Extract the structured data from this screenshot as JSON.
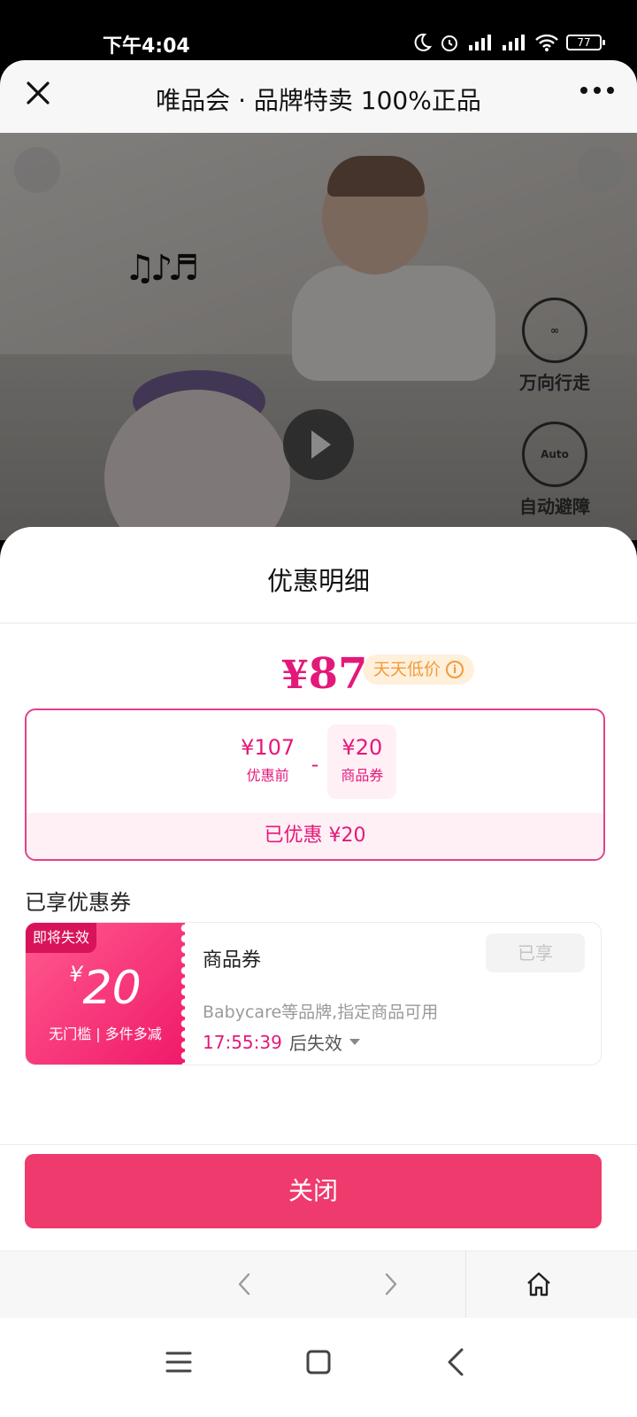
{
  "status_bar": {
    "time": "下午4:04",
    "battery": "77"
  },
  "title_bar": {
    "title": "唯品会 · 品牌特卖 100%正品"
  },
  "hero": {
    "features": [
      "万向行走",
      "自动避障"
    ],
    "auto_label": "Auto"
  },
  "discount_sheet": {
    "title": "优惠明细",
    "final_price": {
      "currency": "¥",
      "value": "87"
    },
    "daily_low_tag": "天天低价",
    "breakdown": [
      {
        "amount": "¥107",
        "label": "优惠前"
      },
      {
        "amount": "¥20",
        "label": "商品券"
      }
    ],
    "operator": "-",
    "saved_text": "已优惠 ¥20",
    "coupons_section_label": "已享优惠券",
    "coupon": {
      "badge": "即将失效",
      "currency": "¥",
      "value": "20",
      "condition": "无门槛 | 多件多减",
      "name": "商品券",
      "status_button": "已享",
      "description": "Babycare等品牌,指定商品可用",
      "countdown": "17:55:39",
      "countdown_suffix": "后失效"
    },
    "close_button": "关闭"
  },
  "colors": {
    "accent": "#e3197a",
    "close_button": "#ee3a6c",
    "tag_bg": "#fff0dc",
    "tag_text": "#f39a3a"
  }
}
